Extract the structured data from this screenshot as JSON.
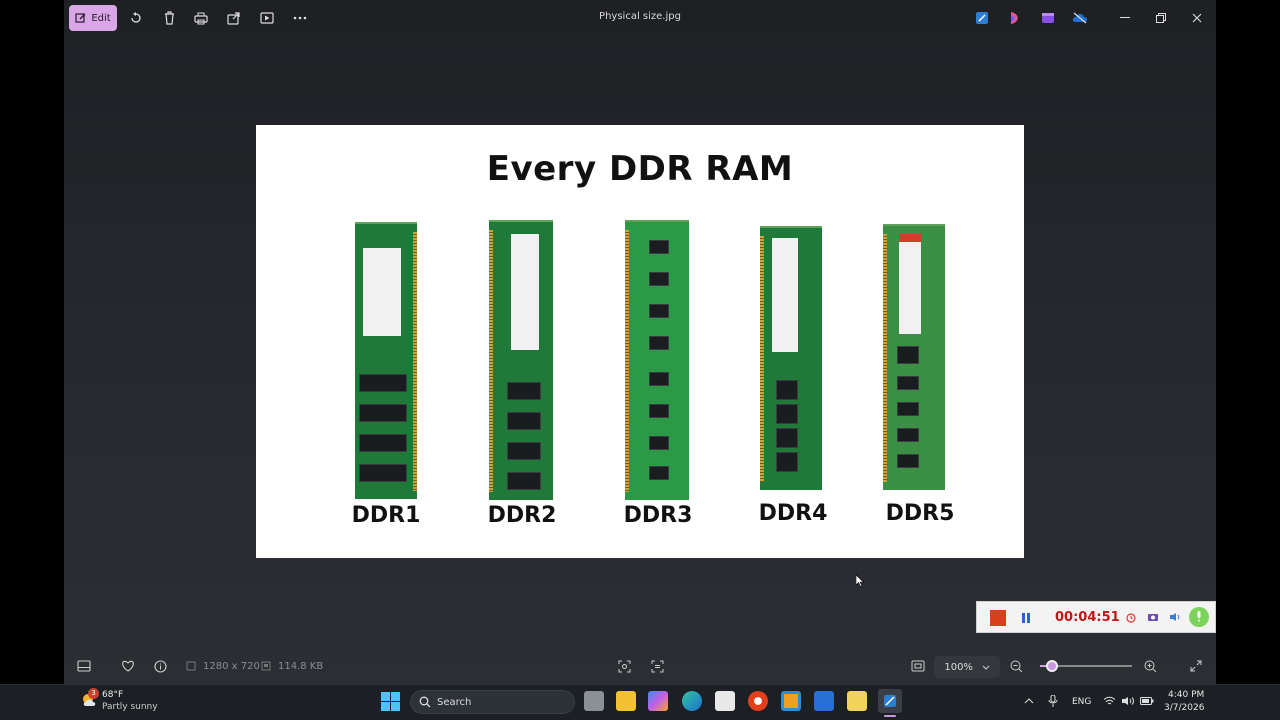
{
  "app": {
    "title": "Physical size.jpg",
    "edit_label": "Edit"
  },
  "image": {
    "title": "Every DDR RAM",
    "modules": [
      "DDR1",
      "DDR2",
      "DDR3",
      "DDR4",
      "DDR5"
    ]
  },
  "recorder": {
    "time": "00:04:51"
  },
  "status": {
    "dimensions": "1280 x 720",
    "file_size": "114.8 KB",
    "zoom": "100%",
    "zoom_fraction": 0.15
  },
  "taskbar": {
    "weather_temp": "68°F",
    "weather_desc": "Partly sunny",
    "weather_badge": "3",
    "search_placeholder": "Search",
    "language": "ENG",
    "time": "4:40 PM",
    "date": "3/7/2026"
  },
  "colors": {
    "accent": "#d9a7e6",
    "pcb_green": "#1f7a3a",
    "recorder_red": "#c41414"
  }
}
